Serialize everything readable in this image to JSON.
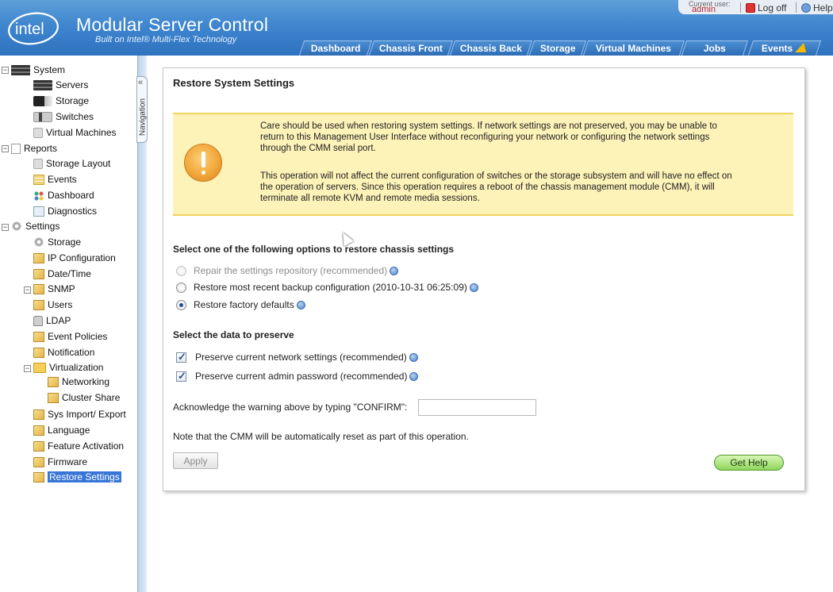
{
  "header": {
    "logo_text": "intel",
    "title": "Modular Server Control",
    "subtitle": "Built on Intel® Multi-Flex Technology",
    "current_user_label": "Current user:",
    "current_user": "admin",
    "logoff_label": "Log off",
    "help_label": "Help",
    "tabs": [
      "Dashboard",
      "Chassis Front",
      "Chassis Back",
      "Storage",
      "Virtual Machines",
      "Jobs",
      "Events"
    ]
  },
  "sidebar": {
    "collapse_glyph": "«",
    "handle_label": "Navigation",
    "items": [
      {
        "label": "System",
        "icon": "server-rack-icon"
      },
      {
        "label": "Servers",
        "icon": "server-icon"
      },
      {
        "label": "Storage",
        "icon": "storage-icon"
      },
      {
        "label": "Switches",
        "icon": "switch-icon"
      },
      {
        "label": "Virtual Machines",
        "icon": "virtual-machine-icon"
      },
      {
        "label": "Reports",
        "icon": "report-icon"
      },
      {
        "label": "Storage Layout",
        "icon": "storage-layout-icon"
      },
      {
        "label": "Events",
        "icon": "events-icon"
      },
      {
        "label": "Dashboard",
        "icon": "dashboard-icon"
      },
      {
        "label": "Diagnostics",
        "icon": "diagnostics-icon"
      },
      {
        "label": "Settings",
        "icon": "gear-icon"
      },
      {
        "label": "Storage",
        "icon": "gear-icon"
      },
      {
        "label": "IP Configuration",
        "icon": "page-icon"
      },
      {
        "label": "Date/Time",
        "icon": "page-icon"
      },
      {
        "label": "SNMP",
        "icon": "page-icon"
      },
      {
        "label": "Users",
        "icon": "page-icon"
      },
      {
        "label": "LDAP",
        "icon": "lock-icon"
      },
      {
        "label": "Event Policies",
        "icon": "page-icon"
      },
      {
        "label": "Notification",
        "icon": "page-icon"
      },
      {
        "label": "Virtualization",
        "icon": "folder-icon"
      },
      {
        "label": "Networking",
        "icon": "page-icon"
      },
      {
        "label": "Cluster Share",
        "icon": "page-icon"
      },
      {
        "label": "Sys Import/ Export",
        "icon": "page-icon"
      },
      {
        "label": "Language",
        "icon": "page-icon"
      },
      {
        "label": "Feature Activation",
        "icon": "page-icon"
      },
      {
        "label": "Firmware",
        "icon": "page-icon"
      },
      {
        "label": "Restore Settings",
        "icon": "page-icon",
        "selected": true
      }
    ]
  },
  "main": {
    "title": "Restore System Settings",
    "warning": {
      "line1": "Care should be used when restoring system settings. If network settings are not preserved, you may be unable to",
      "line2": "return to this Management User Interface without reconfiguring your network or configuring the network settings",
      "line3": "through the CMM serial port.",
      "line4": "This operation will not affect the current configuration of switches or the storage subsystem and will have no effect on",
      "line5": "the operation of servers. Since this operation requires a reboot of the chassis management module (CMM), it will",
      "line6": "terminate all remote KVM and remote media sessions."
    },
    "options_title": "Select one of the following options to restore chassis settings",
    "options": [
      {
        "label": "Repair the settings repository (recommended)",
        "disabled": true,
        "checked": false
      },
      {
        "label": "Restore most recent backup configuration (2010-10-31 06:25:09)",
        "disabled": false,
        "checked": false
      },
      {
        "label": "Restore factory defaults",
        "disabled": false,
        "checked": true
      }
    ],
    "preserve_title": "Select the data to preserve",
    "preserve": [
      {
        "label": "Preserve current network settings (recommended)",
        "checked": true
      },
      {
        "label": "Preserve current admin password (recommended)",
        "checked": true
      }
    ],
    "confirm_label": "Acknowledge the warning above by typing \"CONFIRM\":",
    "confirm_value": "",
    "note": "Note that the CMM will be automatically reset as part of this operation.",
    "apply_label": "Apply",
    "gethelp_label": "Get Help"
  },
  "colors": {
    "header_blue": "#3f86cf",
    "warning_bg": "#fdf2b8",
    "selected_nav": "#3875d7",
    "gethelp_green": "#8fd65b"
  }
}
